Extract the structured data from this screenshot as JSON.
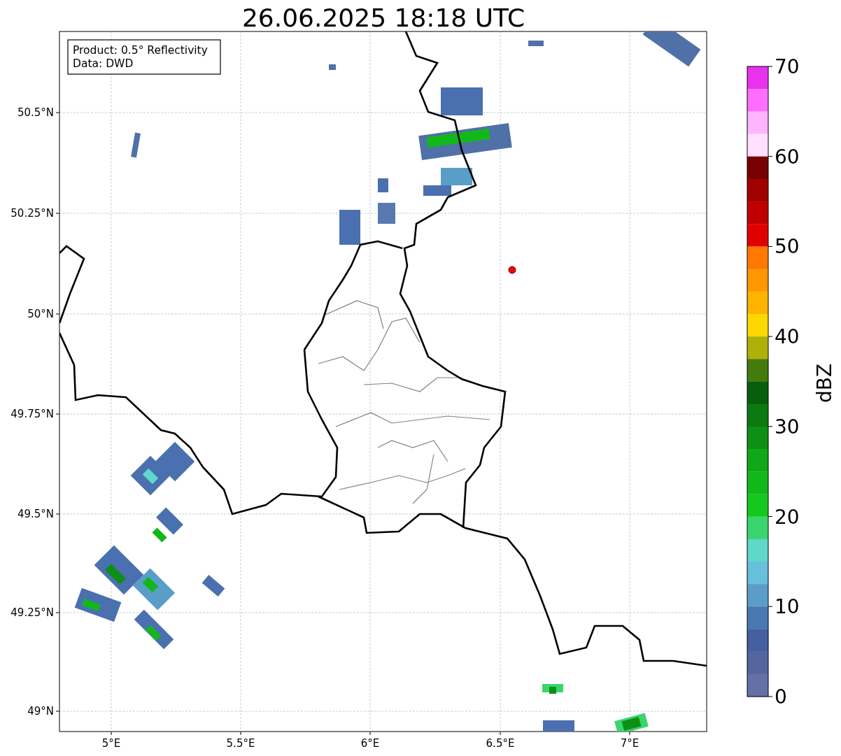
{
  "title": "26.06.2025 18:18 UTC",
  "info_box": [
    "Product: 0.5° Reflectivity",
    "Data: DWD"
  ],
  "lat_ticks": [
    "50.5°N",
    "50.25°N",
    "50°N",
    "49.75°N",
    "49.5°N",
    "49.25°N",
    "49°N"
  ],
  "lon_ticks": [
    "5°E",
    "5.5°E",
    "6°E",
    "6.5°E",
    "7°E"
  ],
  "colorbar": {
    "label": "dBZ",
    "ticks": [
      "70",
      "60",
      "50",
      "40",
      "30",
      "20",
      "10",
      "0"
    ],
    "bins": [
      {
        "color": "#e832f0"
      },
      {
        "color": "#ff6eff"
      },
      {
        "color": "#ffb4ff"
      },
      {
        "color": "#ffe0ff"
      },
      {
        "color": "#780000"
      },
      {
        "color": "#a00000"
      },
      {
        "color": "#c00000"
      },
      {
        "color": "#e00000"
      },
      {
        "color": "#ff7800"
      },
      {
        "color": "#ff9800"
      },
      {
        "color": "#ffb400"
      },
      {
        "color": "#ffd700"
      },
      {
        "color": "#b0b00a"
      },
      {
        "color": "#457a0c"
      },
      {
        "color": "#075e0c"
      },
      {
        "color": "#0b7a10"
      },
      {
        "color": "#0e9014"
      },
      {
        "color": "#10a816"
      },
      {
        "color": "#12b81a"
      },
      {
        "color": "#14c81e"
      },
      {
        "color": "#3cd46c"
      },
      {
        "color": "#5ed8c8"
      },
      {
        "color": "#66c0dc"
      },
      {
        "color": "#5a9ec8"
      },
      {
        "color": "#4a78b0"
      },
      {
        "color": "#4560a0"
      },
      {
        "color": "#5466a0"
      },
      {
        "color": "#6470a6"
      }
    ]
  }
}
